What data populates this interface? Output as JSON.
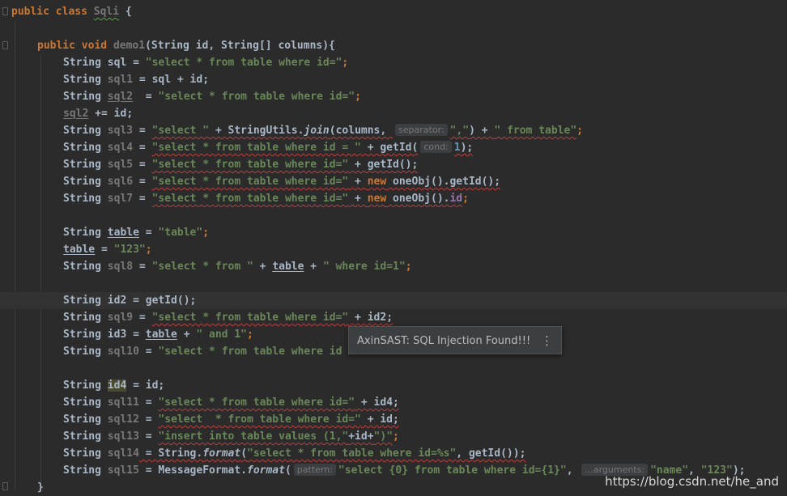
{
  "code": {
    "l1": {
      "kw1": "public",
      "kw2": "class",
      "name": "Sqli",
      "brace": " {"
    },
    "l2": {
      "kw1": "public",
      "kw2": "void",
      "name": "demo1",
      "params": "(String id, String[] columns){"
    },
    "sql": {
      "decl": "String sql = ",
      "str": "\"select * from table where id=\"",
      "end": ";"
    },
    "sql1": {
      "decl": "String ",
      "var": "sql1",
      "rest": " = sql + id;"
    },
    "sql2": {
      "decl": "String ",
      "var": "sql2",
      "eq": "  = ",
      "str": "\"select * from table where id=\"",
      "end": ";"
    },
    "sql2b": {
      "var": "sql2",
      "rest": " += id;"
    },
    "sql3": {
      "decl": "String ",
      "var": "sql3",
      "eq": " = ",
      "s1": "\"select \"",
      "mid": " + StringUtils.",
      "fn": "join",
      "args": "(columns, ",
      "hint": "separator:",
      "s2": "\",\"",
      "plus": ") + ",
      "s3": "\" from table\"",
      "end": ";"
    },
    "sql4": {
      "decl": "String ",
      "var": "sql4",
      "eq": " = ",
      "str": "\"select * from table where id = \"",
      "mid": " + getId(",
      "hint": "cond:",
      "num": "1",
      "end": ");"
    },
    "sql5": {
      "decl": "String ",
      "var": "sql5",
      "eq": " = ",
      "str": "\"select * from table where id=\"",
      "end": " + getId();"
    },
    "sql6": {
      "decl": "String ",
      "var": "sql6",
      "eq": " = ",
      "str": "\"select * from table where id=\"",
      "plus": " + ",
      "kw": "new",
      "end": " oneObj().getId();"
    },
    "sql7": {
      "decl": "String ",
      "var": "sql7",
      "eq": " = ",
      "str": "\"select * from table where id=\"",
      "plus": " + ",
      "kw": "new",
      "mid": " oneObj().",
      "field": "id",
      "end": ";"
    },
    "table1": {
      "decl": "String ",
      "var": "table",
      "eq": " = ",
      "str": "\"table\"",
      "end": ";"
    },
    "table2": {
      "var": "table",
      "eq": " = ",
      "str": "\"123\"",
      "end": ";"
    },
    "sql8": {
      "decl": "String ",
      "var": "sql8",
      "eq": " = ",
      "s1": "\"select * from \"",
      "plus": " + ",
      "tbl": "table",
      "plus2": " + ",
      "s2": "\" where id=1\"",
      "end": ";"
    },
    "id2": {
      "decl": "String id2 = getId();"
    },
    "sql9": {
      "decl": "String ",
      "var": "sql9",
      "eq": " = ",
      "str": "\"select * from table where id=\"",
      "end": " + id2;"
    },
    "id3": {
      "decl": "String id3 = ",
      "tbl": "table",
      "plus": " + ",
      "str": "\" and 1\"",
      "end": ";"
    },
    "sql10": {
      "decl": "String ",
      "var": "sql10",
      "eq": " = ",
      "str": "\"select * from table where id"
    },
    "id4": {
      "decl": "String ",
      "var": "id4",
      "rest": " = id;"
    },
    "sql11": {
      "decl": "String ",
      "var": "sql11",
      "eq": " = ",
      "str": "\"select * from table where id=\"",
      "end": " + id4;"
    },
    "sql12": {
      "decl": "String ",
      "var": "sql12",
      "eq": " = ",
      "str": "\"select  * from table where id=\"",
      "end": " + id;"
    },
    "sql13": {
      "decl": "String ",
      "var": "sql13",
      "eq": " = ",
      "s1": "\"insert into table values (1,\"",
      "mid": "+id+",
      "s2": "\")\"",
      "end": ";"
    },
    "sql14": {
      "decl": "String ",
      "var": "sql14",
      "eq": " = String.",
      "fn": "format",
      "p": "(",
      "str": "\"select * from table where id=%s\"",
      "end": ", getId());"
    },
    "sql15": {
      "decl": "String ",
      "var": "sql15",
      "eq": " = MessageFormat.",
      "fn": "format",
      "p": "(",
      "hint1": "pattern:",
      "str": "\"select {0} from table where id={1}\"",
      "comma": ", ",
      "hint2": "...arguments:",
      "s2": "\"name\"",
      "comma2": ", ",
      "s3": "\"123\"",
      "end": ");"
    },
    "close": "}"
  },
  "tooltip": {
    "message": "AxinSAST: SQL Injection Found!!!",
    "more_icon": "⋮"
  },
  "watermark": "https://blog.csdn.net/he_and",
  "colors": {
    "background": "#2b2b2b",
    "keyword": "#cc7832",
    "string": "#6a8759",
    "error_underline": "#bc3f3c"
  }
}
